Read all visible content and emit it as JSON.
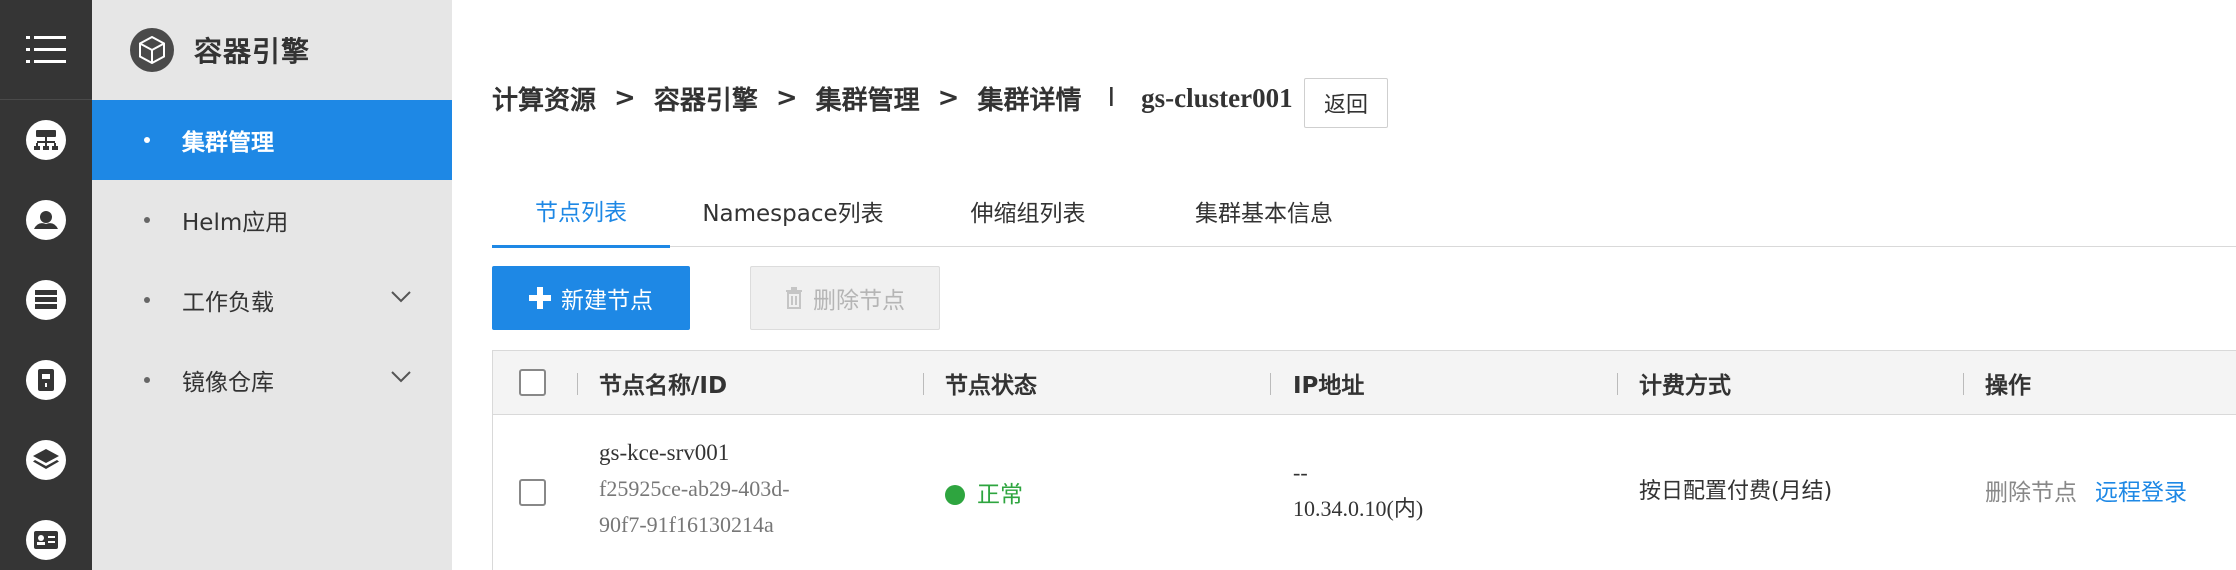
{
  "rail": {
    "menu_icon": "menu-icon",
    "items": [
      {
        "icon": "network-icon"
      },
      {
        "icon": "cloud-icon"
      },
      {
        "icon": "server-icon"
      },
      {
        "icon": "storage-icon"
      },
      {
        "icon": "layers-icon"
      },
      {
        "icon": "id-card-icon"
      }
    ]
  },
  "nav": {
    "title": "容器引擎",
    "logo_icon": "cube-icon",
    "items": [
      {
        "label": "集群管理",
        "active": true
      },
      {
        "label": "Helm应用",
        "active": false
      },
      {
        "label": "工作负载",
        "expandable": true
      },
      {
        "label": "镜像仓库",
        "expandable": true
      }
    ]
  },
  "breadcrumb": {
    "items": [
      "计算资源",
      "容器引擎",
      "集群管理",
      "集群详情"
    ],
    "separator": ">",
    "divider": "I",
    "cluster": "gs-cluster001",
    "back_label": "返回"
  },
  "tabs": [
    {
      "label": "节点列表",
      "active": true
    },
    {
      "label": "Namespace列表"
    },
    {
      "label": "伸缩组列表"
    },
    {
      "label": "集群基本信息"
    }
  ],
  "toolbar": {
    "new_label": "新建节点",
    "delete_label": "删除节点"
  },
  "table": {
    "headers": [
      "节点名称/ID",
      "节点状态",
      "IP地址",
      "计费方式",
      "操作"
    ],
    "rows": [
      {
        "name": "gs-kce-srv001",
        "id_line1": "f25925ce-ab29-403d-",
        "id_line2": "90f7-91f16130214a",
        "status": "正常",
        "ip_public": "--",
        "ip_private": "10.34.0.10(内)",
        "billing": "按日配置付费(月结)",
        "op_delete": "删除节点",
        "op_login": "远程登录"
      }
    ]
  },
  "colors": {
    "accent": "#1e88e5",
    "rail_bg": "#353535",
    "nav_bg": "#e6e6e6",
    "status_ok": "#2ea53f"
  }
}
